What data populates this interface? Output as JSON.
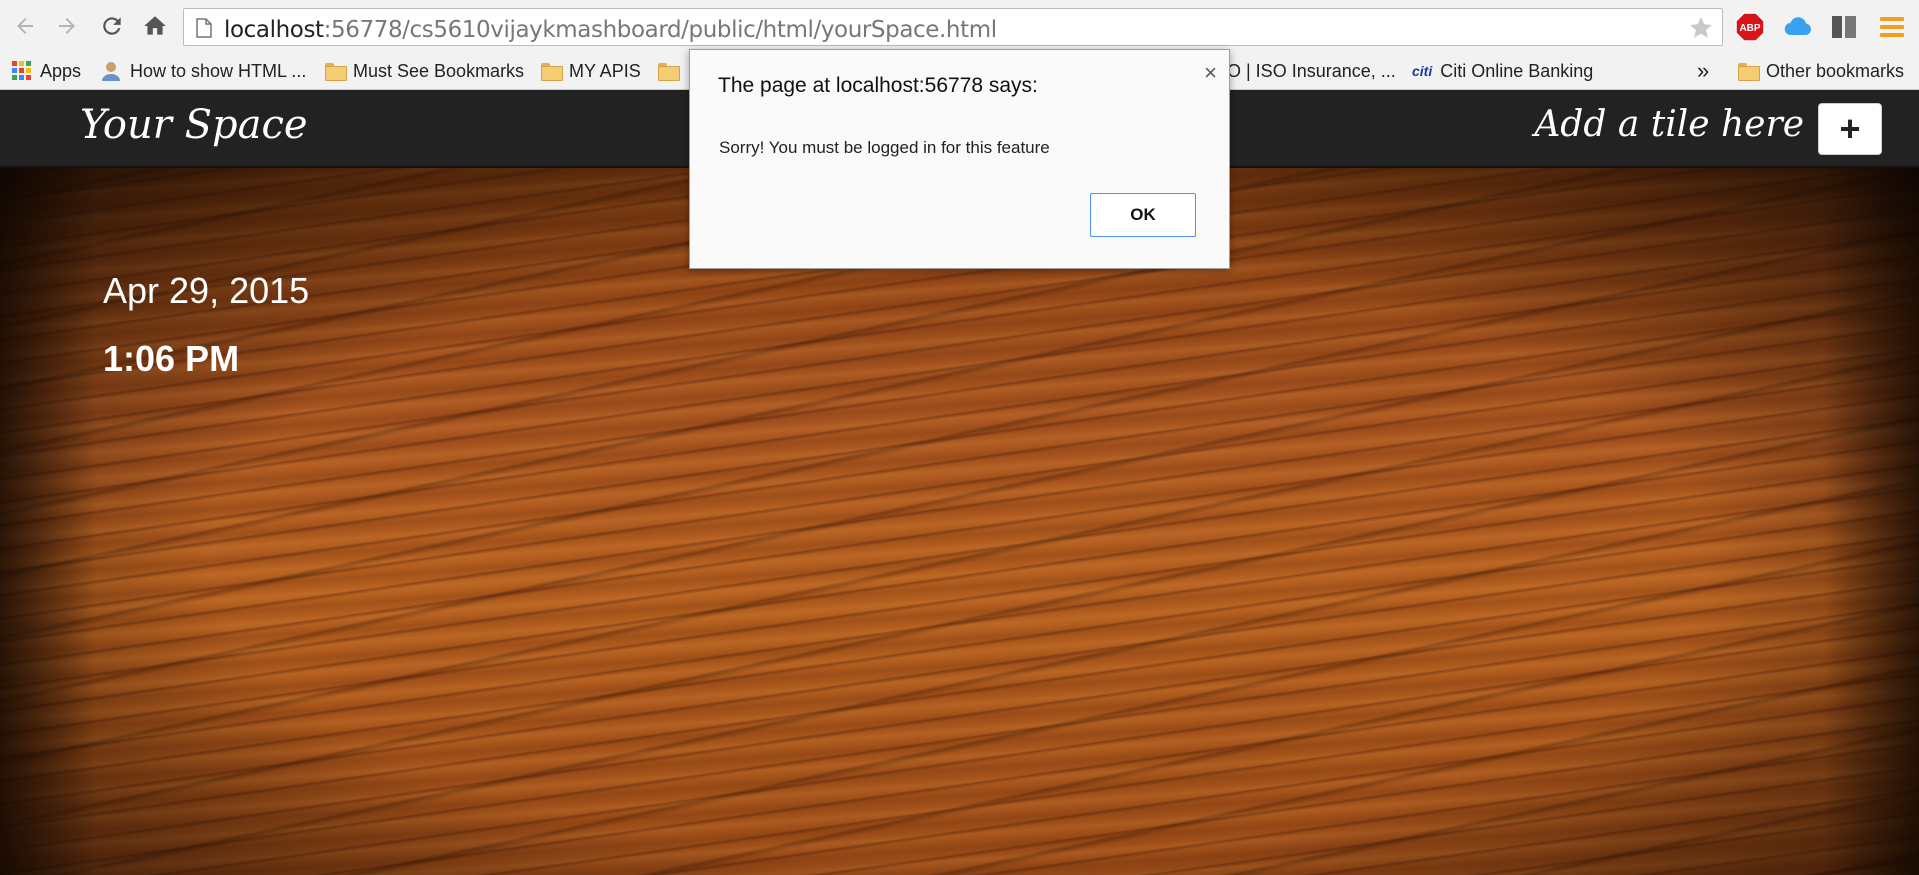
{
  "browser": {
    "url_host": "localhost",
    "url_rest": ":56778/cs5610vijaykmashboard/public/html/yourSpace.html",
    "extensions": [
      "adblock-plus-icon",
      "cloud-icon",
      "panels-icon",
      "menu-icon"
    ],
    "abp_label": "ABP"
  },
  "bookmarks": {
    "apps": "Apps",
    "item1": "How to show HTML ...",
    "item2": "Must See Bookmarks",
    "item3": "MY APIS",
    "item4": "SO | ISO Insurance, ...",
    "item5": "Citi Online Banking",
    "citi_logo": "citi",
    "overflow": "»",
    "other": "Other bookmarks"
  },
  "navbar": {
    "brand": "Your Space",
    "add_tile_text": "Add a tile here",
    "add_button": "+"
  },
  "main": {
    "date": "Apr 29, 2015",
    "time": "1:06 PM"
  },
  "dialog": {
    "title": "The page at localhost:56778 says:",
    "close": "×",
    "message": "Sorry! You must be logged in for this feature",
    "ok": "OK"
  },
  "colors": {
    "navbar_bg": "#222222",
    "wood": "#a95620",
    "ok_border": "#4d90fe"
  }
}
